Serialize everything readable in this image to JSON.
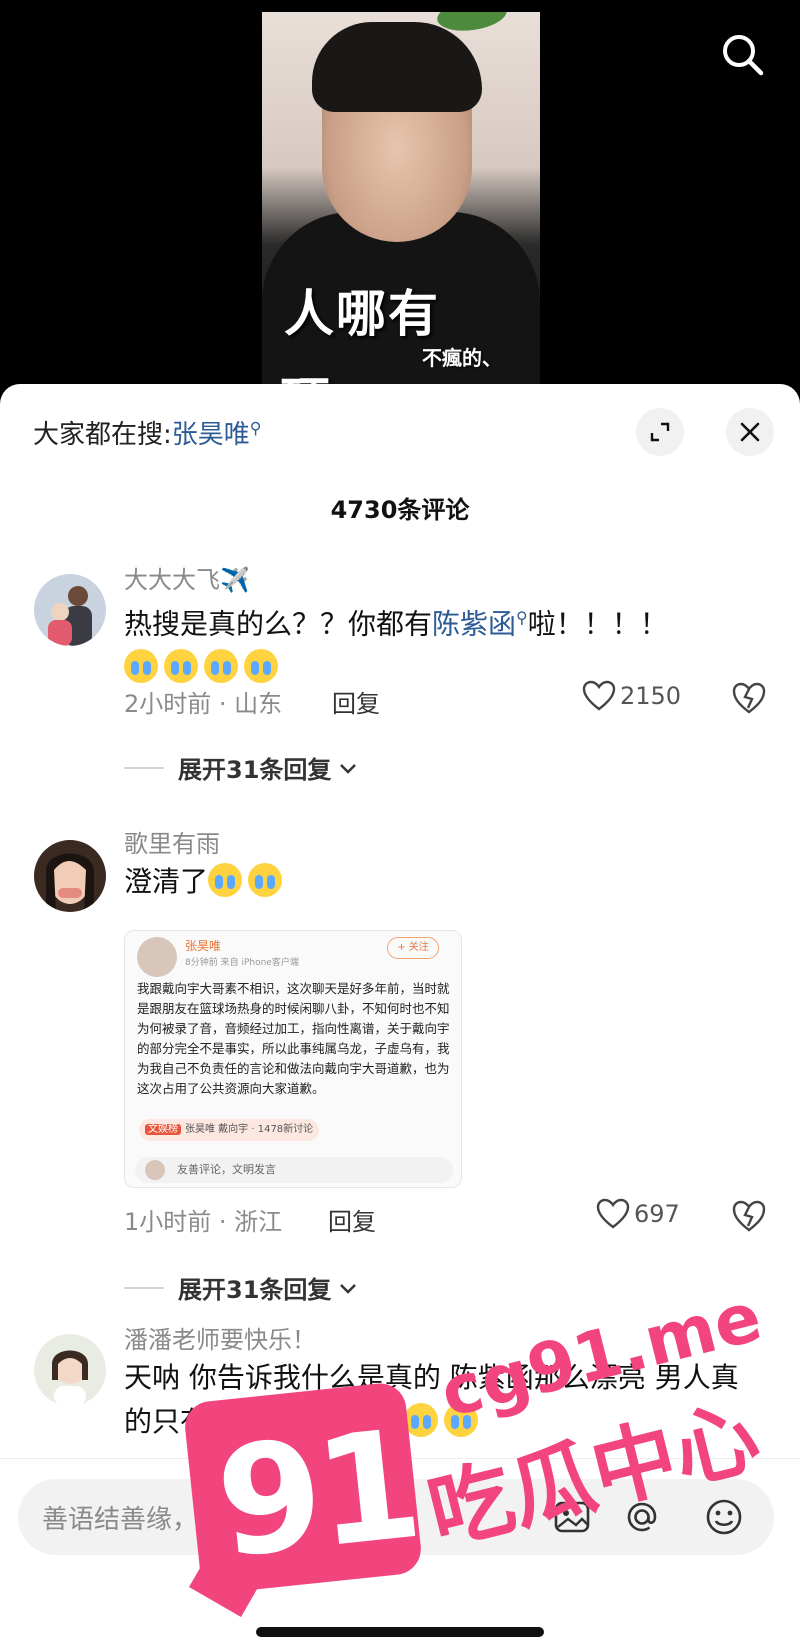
{
  "video": {
    "caption_big": "人哪有",
    "caption_small": "不瘋的、",
    "caption_cut": "硬",
    "search_icon": "search-icon"
  },
  "sheet": {
    "hot_search_prefix": "大家都在搜:",
    "hot_search_keyword": "张昊唯",
    "comment_count": "4730条评论",
    "expand_icon": "expand-icon",
    "close_icon": "close-icon"
  },
  "comments": [
    {
      "user": "大大大飞✈️",
      "text_before": "热搜是真的么？？你都有",
      "text_keyword": "陈紫函",
      "text_after": "啦！！！！",
      "emojis": 4,
      "meta": "2小时前 · 山东",
      "reply_label": "回复",
      "likes": "2150",
      "expand_label": "展开31条回复",
      "expand_chevron": "⌄"
    },
    {
      "user": "歌里有雨",
      "text": "澄清了",
      "emojis": 2,
      "meta": "1小时前 · 浙江",
      "reply_label": "回复",
      "likes": "697",
      "expand_label": "展开31条回复",
      "expand_chevron": "⌄",
      "image": {
        "name": "张昊唯",
        "time": "8分钟前  来自 iPhone客户端",
        "follow": "+ 关注",
        "body": "我跟戴向宇大哥素不相识，这次聊天是好多年前，当时就是跟朋友在篮球场热身的时候闲聊八卦，不知何时也不知为何被录了音，音频经过加工，指向性离谱，关于戴向宇的部分完全不是事实，所以此事纯属乌龙，子虚乌有，我为我自己不负责任的言论和做法向戴向宇大哥道歉，也为这次占用了公共资源向大家道歉。",
        "tag_badge": "文娱榜",
        "tag_text": "张昊唯 戴向宇 · 1478新讨论",
        "input_placeholder": "友善评论，文明发言"
      }
    },
    {
      "user": "潘潘老师要快乐！",
      "text": "天呐 你告诉我什么是真的 陈紫函那么漂亮 男人真的只有挂墙上才会老实"
    }
  ],
  "input_bar": {
    "placeholder": "善语结善缘，恶言伤人心",
    "icons": [
      "image-icon",
      "at-icon",
      "emoji-icon"
    ]
  },
  "watermark": {
    "number": "91",
    "url": "cg91.me",
    "text": "吃瓜中心"
  },
  "colors": {
    "keyword": "#2d5b96",
    "watermark": "#f2457e",
    "muted": "#8a8a8a"
  }
}
